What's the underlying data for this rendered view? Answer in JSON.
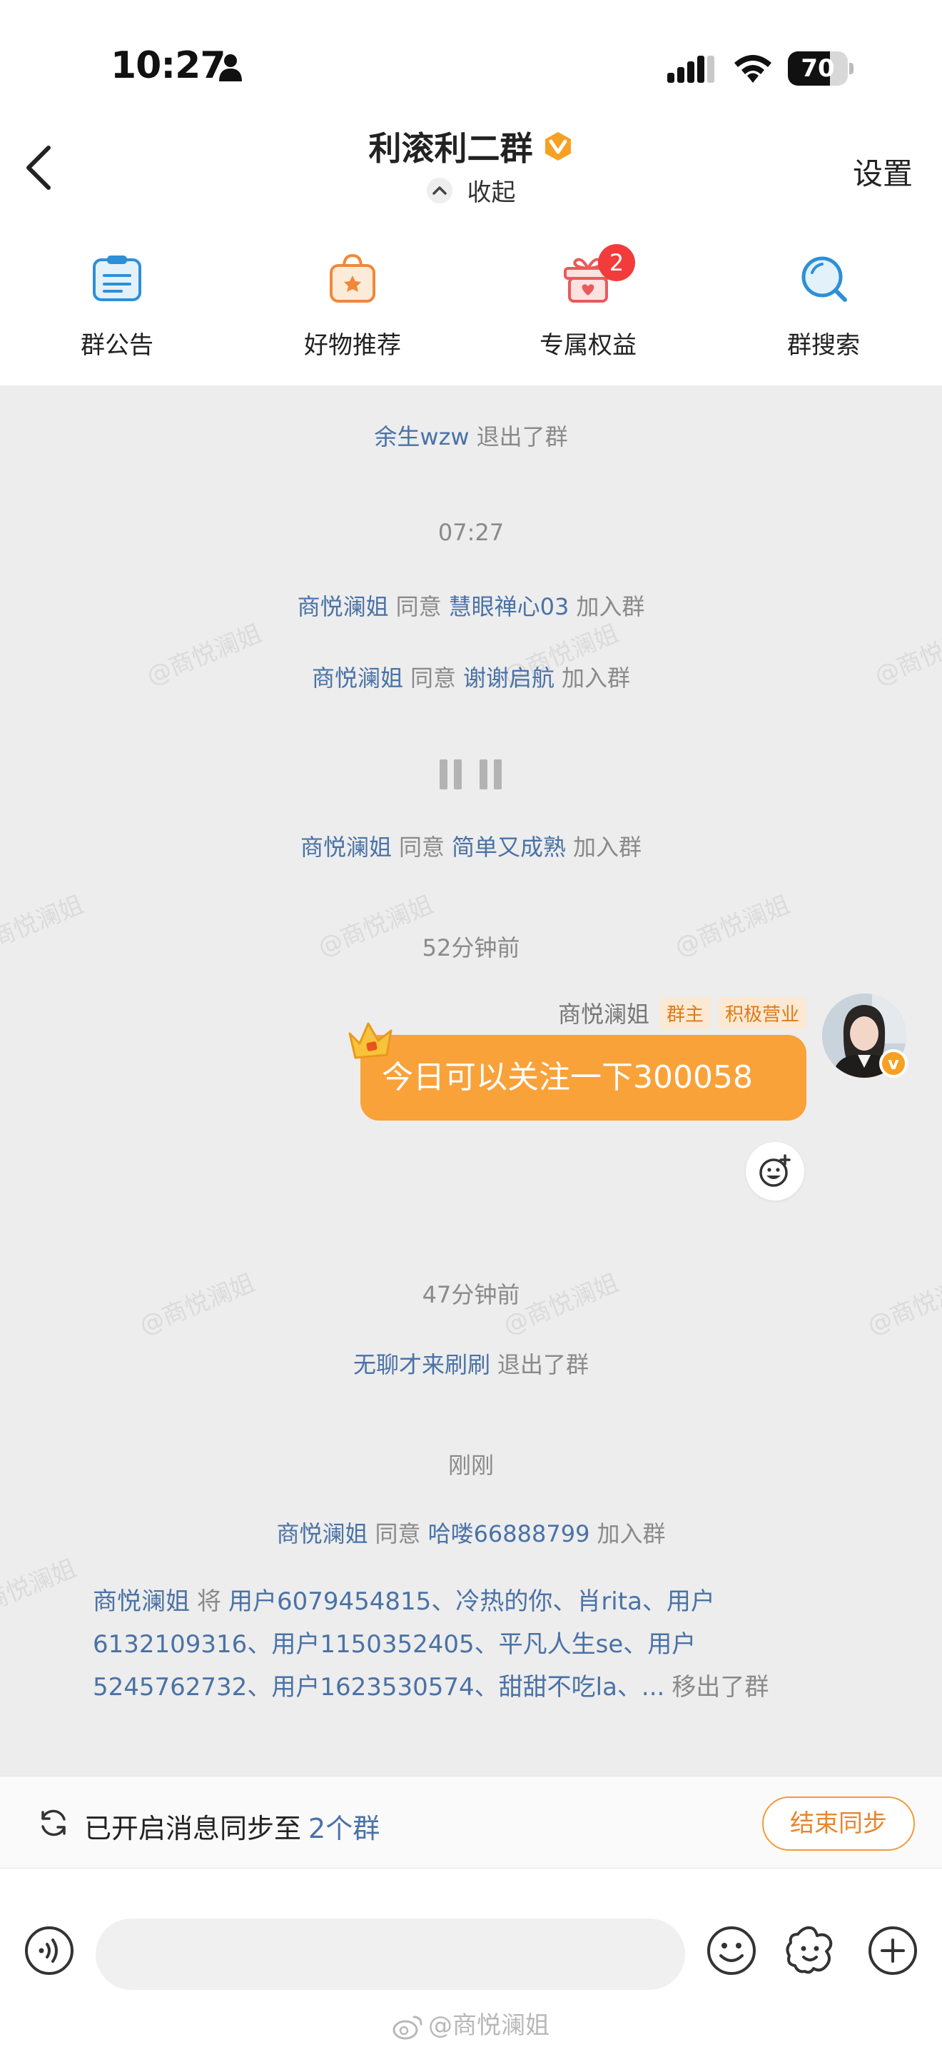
{
  "status_bar": {
    "time": "10:27",
    "battery_level": "70",
    "battery_fraction": 0.7
  },
  "header": {
    "title": "利滚利二群",
    "collapse_label": "收起",
    "settings_label": "设置"
  },
  "quick_actions": [
    {
      "label": "群公告",
      "icon": "notice-icon"
    },
    {
      "label": "好物推荐",
      "icon": "shopping-bag-icon"
    },
    {
      "label": "专属权益",
      "icon": "gift-icon",
      "badge": "2"
    },
    {
      "label": "群搜索",
      "icon": "search-icon"
    }
  ],
  "messages": {
    "m1": {
      "name": "余生wzw",
      "action": "退出了群"
    },
    "t1": "07:27",
    "m2": {
      "actor": "商悦澜姐",
      "verb": "同意",
      "target": "慧眼禅心03",
      "action": "加入群"
    },
    "m3": {
      "actor": "商悦澜姐",
      "verb": "同意",
      "target": "谢谢启航",
      "action": "加入群"
    },
    "m4": {
      "actor": "商悦澜姐",
      "verb": "同意",
      "target": "简单又成熟",
      "action": "加入群"
    },
    "t2": "52分钟前",
    "chat_msg": {
      "sender": "商悦澜姐",
      "tag_owner": "群主",
      "tag_active": "积极营业",
      "text": "今日可以关注一下300058"
    },
    "t3": "47分钟前",
    "m5": {
      "name": "无聊才来刷刷",
      "action": "退出了群"
    },
    "t4": "刚刚",
    "m6": {
      "actor": "商悦澜姐",
      "verb": "同意",
      "target": "哈喽66888799",
      "action": "加入群"
    },
    "m7": {
      "actor": "商悦澜姐",
      "verb": "将",
      "targets": "用户6079454815、冷热的你、肖rita、用户6132109316、用户1150352405、平凡人生se、用户5245762732、用户1623530574、甜甜不吃la、...",
      "action": "移出了群"
    }
  },
  "watermark": "@商悦澜姐",
  "sync": {
    "text": "已开启消息同步至",
    "count": "2个群",
    "end_button": "结束同步"
  },
  "input": {
    "placeholder": ""
  },
  "colors": {
    "accent_orange": "#f9a23a",
    "name_blue": "#4a72a6",
    "badge_red": "#f23b3b"
  }
}
